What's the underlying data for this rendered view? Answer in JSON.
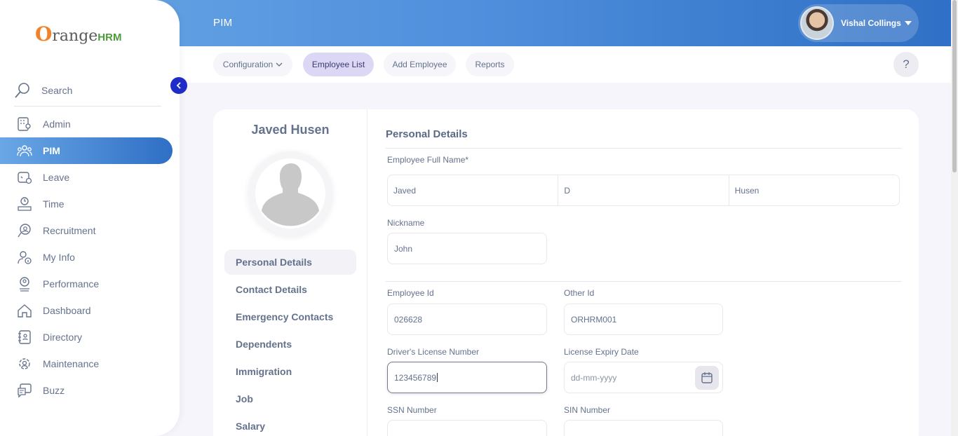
{
  "header": {
    "module": "PIM",
    "user_name": "Vishal Collings"
  },
  "subnav": {
    "items": [
      "Configuration",
      "Employee List",
      "Add Employee",
      "Reports"
    ],
    "help": "?"
  },
  "sidebar": {
    "logo_o": "O",
    "logo_range": "range",
    "logo_hrm": "HRM",
    "search_label": "Search",
    "items": [
      {
        "label": "Admin",
        "icon": "admin-icon"
      },
      {
        "label": "PIM",
        "icon": "pim-icon"
      },
      {
        "label": "Leave",
        "icon": "leave-icon"
      },
      {
        "label": "Time",
        "icon": "time-icon"
      },
      {
        "label": "Recruitment",
        "icon": "recruitment-icon"
      },
      {
        "label": "My Info",
        "icon": "my-info-icon"
      },
      {
        "label": "Performance",
        "icon": "performance-icon"
      },
      {
        "label": "Dashboard",
        "icon": "dashboard-icon"
      },
      {
        "label": "Directory",
        "icon": "directory-icon"
      },
      {
        "label": "Maintenance",
        "icon": "maintenance-icon"
      },
      {
        "label": "Buzz",
        "icon": "buzz-icon"
      }
    ],
    "active": "PIM"
  },
  "profile": {
    "name": "Javed Husen",
    "tabs": [
      "Personal Details",
      "Contact Details",
      "Emergency Contacts",
      "Dependents",
      "Immigration",
      "Job",
      "Salary"
    ],
    "active_tab": "Personal Details"
  },
  "form": {
    "section_title": "Personal Details",
    "full_name_label": "Employee Full Name*",
    "first_name": "Javed",
    "middle_name": "D",
    "last_name": "Husen",
    "nickname_label": "Nickname",
    "nickname": "John",
    "employee_id_label": "Employee Id",
    "employee_id": "026628",
    "other_id_label": "Other Id",
    "other_id": "ORHRM001",
    "license_label": "Driver's License Number",
    "license": "123456789",
    "license_expiry_label": "License Expiry Date",
    "license_expiry_placeholder": "dd-mm-yyyy",
    "ssn_label": "SSN Number",
    "sin_label": "SIN Number"
  },
  "colors": {
    "brand_gradient_start": "#6aa7e6",
    "brand_gradient_end": "#2f6fc5",
    "active_pill": "#dcd7f4",
    "collapse_button": "#1f2cc8"
  }
}
